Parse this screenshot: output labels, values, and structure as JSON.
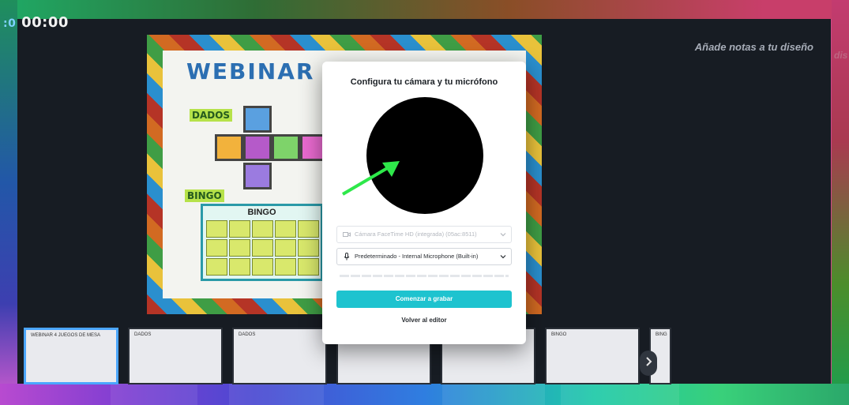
{
  "session": {
    "timer": "00:00",
    "timer_ghost": ":0"
  },
  "notes": {
    "placeholder": "Añade notas a tu diseño",
    "ghost": "dis"
  },
  "slide": {
    "title": "WEBINAR 4 .",
    "dice_label": "DADOS",
    "bingo_label": "BINGO",
    "bingo_header": "BINGO"
  },
  "dialog": {
    "title": "Configura tu cámara y tu micrófono",
    "camera_select": "Cámara FaceTime HD (integrada) (05ac:8511)",
    "mic_select": "Predeterminado - Internal Microphone (Built-in)",
    "record_button": "Comenzar a grabar",
    "back_link": "Volver al editor"
  },
  "thumbnails": [
    {
      "label": "WEBINAR 4 JUEGOS DE MESA",
      "active": true
    },
    {
      "label": "DADOS",
      "active": false
    },
    {
      "label": "DADOS",
      "active": false
    },
    {
      "label": "",
      "active": false
    },
    {
      "label": "",
      "active": false
    },
    {
      "label": "BINGO",
      "active": false
    },
    {
      "label": "BING",
      "active": false
    }
  ],
  "colors": {
    "accent": "#1ec3cf",
    "stage_bg": "#171c23",
    "arrow": "#2ee84a"
  }
}
